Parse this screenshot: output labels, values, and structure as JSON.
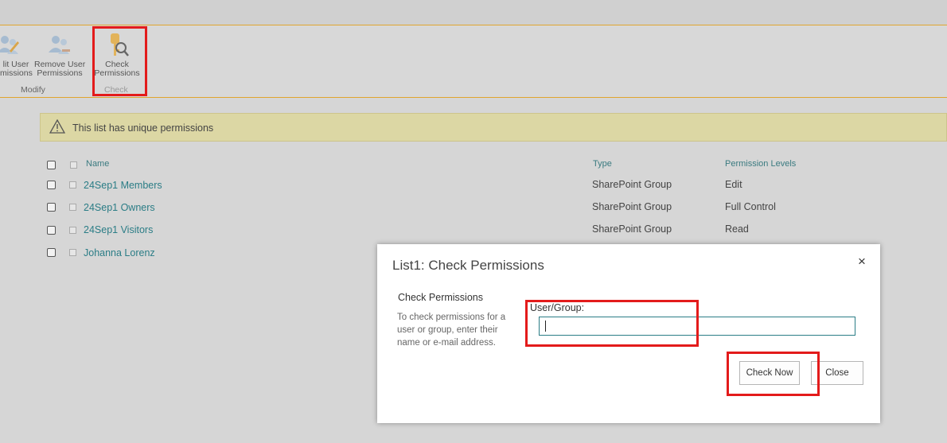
{
  "ribbon": {
    "edit_user": "lit User\nmissions",
    "remove_user": "Remove User\nPermissions",
    "check_perm": "Check\nPermissions",
    "group_modify": "Modify",
    "group_check": "Check"
  },
  "banner": {
    "text": "This list has unique permissions"
  },
  "table": {
    "headers": {
      "name": "Name",
      "type": "Type",
      "levels": "Permission Levels"
    },
    "rows": [
      {
        "name": "24Sep1 Members",
        "type": "SharePoint Group",
        "level": "Edit"
      },
      {
        "name": "24Sep1 Owners",
        "type": "SharePoint Group",
        "level": "Full Control"
      },
      {
        "name": "24Sep1 Visitors",
        "type": "SharePoint Group",
        "level": "Read"
      },
      {
        "name": "Johanna Lorenz",
        "type": "",
        "level": ""
      }
    ]
  },
  "dialog": {
    "title": "List1: Check Permissions",
    "close": "×",
    "section_title": "Check Permissions",
    "section_desc": "To check permissions for a user or group, enter their name or e-mail address.",
    "field_label": "User/Group:",
    "input_value": "",
    "check_now": "Check Now",
    "close_btn": "Close"
  },
  "icons": [
    "people-edit-icon",
    "people-remove-icon",
    "key-magnifier-icon",
    "warning-icon"
  ],
  "colors": {
    "accent": "#2b7d86",
    "highlight": "#e31b1b",
    "banner": "#dcd7a4"
  }
}
